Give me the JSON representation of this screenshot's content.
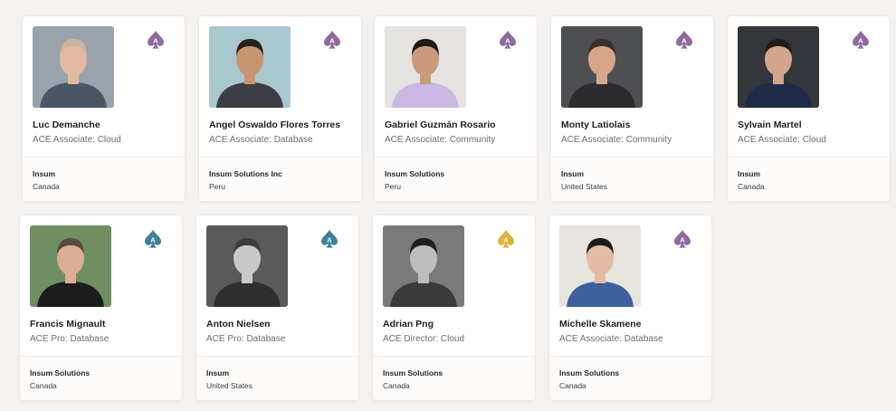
{
  "colors": {
    "associate_icon": "#8d6b9e",
    "pro_icon": "#3f7e9c",
    "director_icon": "#e0b23a"
  },
  "members": [
    {
      "name": "Luc Demanche",
      "level": "ACE Associate: Cloud",
      "company": "Insum",
      "country": "Canada",
      "badge_icon": "ace-associate-icon",
      "badge_color": "#8d6b9e",
      "photo_bg": "#9aa3ab",
      "skin": "#e3b9a1",
      "hair": "#cdb39d",
      "shirt": "#4a5566"
    },
    {
      "name": "Angel Oswaldo Flores Torres",
      "level": "ACE Associate: Database",
      "company": "Insum Solutions Inc",
      "country": "Peru",
      "badge_icon": "ace-associate-icon",
      "badge_color": "#8d6b9e",
      "photo_bg": "#a9c7cf",
      "skin": "#c7956f",
      "hair": "#2a201b",
      "shirt": "#3c3e44"
    },
    {
      "name": "Gabriel Guzmán Rosario",
      "level": "ACE Associate: Community",
      "company": "Insum Solutions",
      "country": "Peru",
      "badge_icon": "ace-associate-icon",
      "badge_color": "#8d6b9e",
      "photo_bg": "#e5e3e1",
      "skin": "#c99a7b",
      "hair": "#1f1915",
      "shirt": "#c9b8e2"
    },
    {
      "name": "Monty Latiolais",
      "level": "ACE Associate: Community",
      "company": "Insum",
      "country": "United States",
      "badge_icon": "ace-associate-icon",
      "badge_color": "#8d6b9e",
      "photo_bg": "#4d4f53",
      "skin": "#d6a68a",
      "hair": "#3a2f29",
      "shirt": "#2c2c2e"
    },
    {
      "name": "Sylvain Martel",
      "level": "ACE Associate: Cloud",
      "company": "Insum",
      "country": "Canada",
      "badge_icon": "ace-associate-icon",
      "badge_color": "#8d6b9e",
      "photo_bg": "#323539",
      "skin": "#d2a68c",
      "hair": "#221b17",
      "shirt": "#1d2a48"
    },
    {
      "name": "Francis Mignault",
      "level": "ACE Pro: Database",
      "company": "Insum Solutions",
      "country": "Canada",
      "badge_icon": "ace-pro-icon",
      "badge_color": "#3f7e9c",
      "photo_bg": "#6f8f62",
      "skin": "#dcae94",
      "hair": "#5a4a40",
      "shirt": "#1c1c1c"
    },
    {
      "name": "Anton Nielsen",
      "level": "ACE Pro: Database",
      "company": "Insum",
      "country": "United States",
      "badge_icon": "ace-pro-icon",
      "badge_color": "#3f7e9c",
      "photo_bg": "#5a5a5a",
      "skin": "#c8c8c8",
      "hair": "#3c3c3c",
      "shirt": "#2e2e2e"
    },
    {
      "name": "Adrian Png",
      "level": "ACE Director: Cloud",
      "company": "Insum Solutions",
      "country": "Canada",
      "badge_icon": "ace-director-icon",
      "badge_color": "#e0b23a",
      "photo_bg": "#7a7a7a",
      "skin": "#bdbdbd",
      "hair": "#1e1e1e",
      "shirt": "#3a3a3a"
    },
    {
      "name": "Michelle Skamene",
      "level": "ACE Associate: Database",
      "company": "Insum Solutions",
      "country": "Canada",
      "badge_icon": "ace-associate-icon",
      "badge_color": "#8d6b9e",
      "photo_bg": "#e8e4df",
      "skin": "#e4bba5",
      "hair": "#1c1a1c",
      "shirt": "#3d5f9c"
    }
  ]
}
